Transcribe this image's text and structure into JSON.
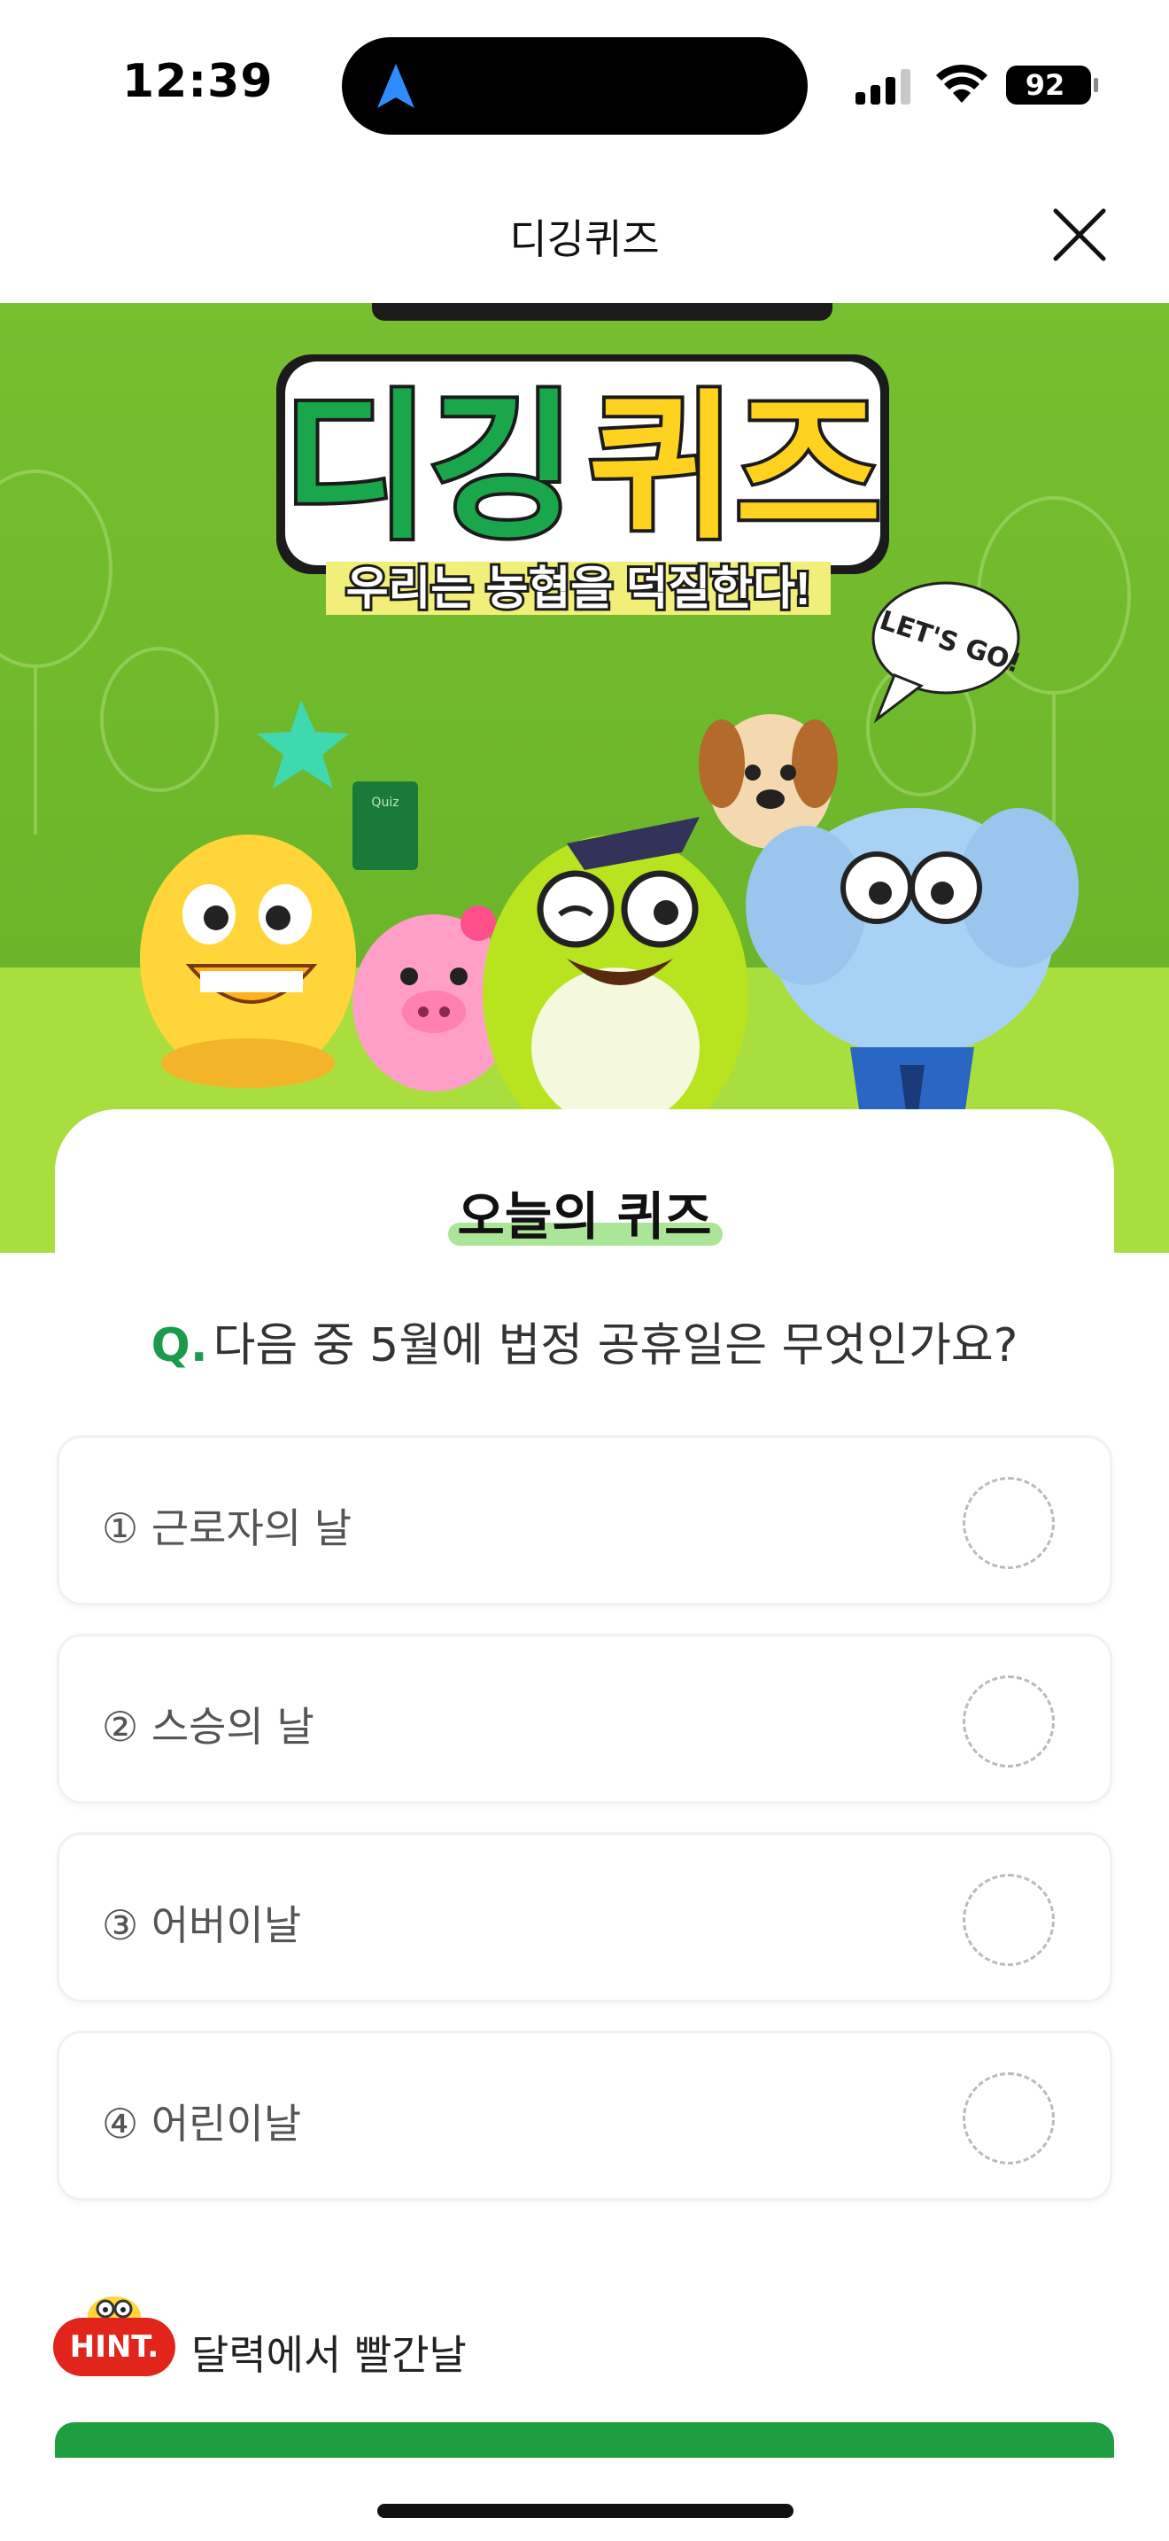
{
  "status_bar": {
    "time": "12:39",
    "battery": "92",
    "icons": [
      "navigation-arrow-icon",
      "signal-icon",
      "wifi-icon",
      "battery-icon"
    ]
  },
  "header": {
    "title": "디깅퀴즈",
    "close_icon": "close-icon"
  },
  "hero": {
    "logo_main_left": "디깅",
    "logo_main_right": "퀴즈",
    "tagline": "우리는 농협을 덕질한다!",
    "speech_bubble": "LET'S GO!",
    "book_label": "Quiz",
    "colors": {
      "green_bg": "#76bf2f",
      "logo_green": "#1aa64a",
      "logo_yellow": "#ffd21f"
    }
  },
  "quiz": {
    "section_title": "오늘의 퀴즈",
    "question_mark": "Q.",
    "question": "다음 중 5월에 법정 공휴일은 무엇인가요?",
    "options": [
      {
        "label": "① 근로자의 날"
      },
      {
        "label": "② 스승의 날"
      },
      {
        "label": "③ 어버이날"
      },
      {
        "label": "④ 어린이날"
      }
    ]
  },
  "hint": {
    "badge": "HINT.",
    "text": "달력에서 빨간날"
  },
  "colors": {
    "accent_green": "#1a9a4a",
    "hint_red": "#e1251b",
    "button_green": "#1f9e3f"
  }
}
